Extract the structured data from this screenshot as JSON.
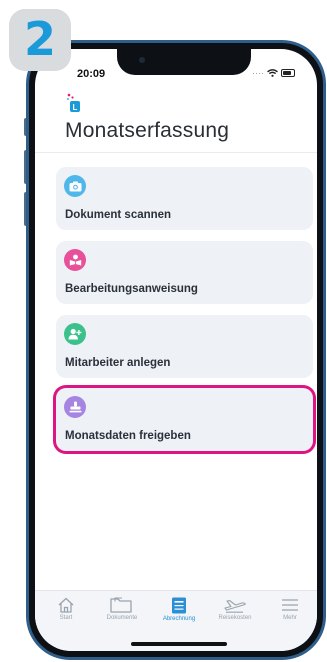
{
  "step": "2",
  "status": {
    "time": "20:09"
  },
  "header": {
    "title": "Monatserfassung"
  },
  "actions": [
    {
      "label": "Dokument scannen",
      "icon": "camera-icon",
      "color": "#4fb7ea"
    },
    {
      "label": "Bearbeitungsanweisung",
      "icon": "book-user-icon",
      "color": "#e9509a"
    },
    {
      "label": "Mitarbeiter anlegen",
      "icon": "add-user-icon",
      "color": "#3cc18d"
    },
    {
      "label": "Monatsdaten freigeben",
      "icon": "stamp-icon",
      "color": "#a685e2"
    }
  ],
  "highlight_color": "#dc1582",
  "tabs": [
    {
      "label": "Start",
      "icon": "home-icon",
      "active": false
    },
    {
      "label": "Dokumente",
      "icon": "folder-icon",
      "active": false
    },
    {
      "label": "Abrechnung",
      "icon": "billing-icon",
      "active": true
    },
    {
      "label": "Reisekosten",
      "icon": "plane-icon",
      "active": false
    },
    {
      "label": "Mehr",
      "icon": "menu-icon",
      "active": false
    }
  ],
  "accent_color": "#2a8fd4"
}
